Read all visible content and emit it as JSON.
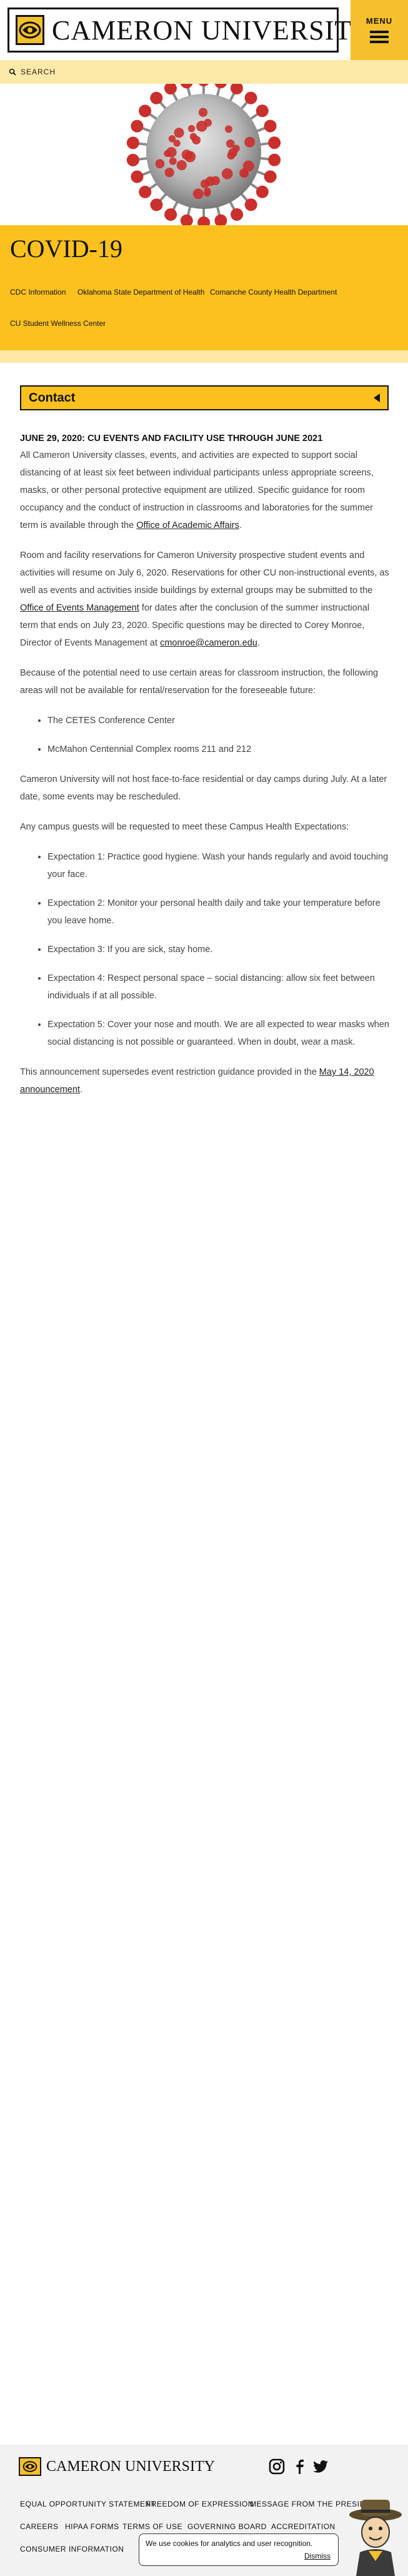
{
  "header": {
    "logo_text": "CAMERON UNIVERSITY",
    "menu_label": "MENU"
  },
  "search": {
    "label": "SEARCH"
  },
  "hero": {
    "title": "COVID-19"
  },
  "band_links": [
    {
      "label": "CDC Information"
    },
    {
      "label": "Oklahoma State Department of Health"
    },
    {
      "label": "Comanche County Health Department"
    },
    {
      "label": "CU Student Wellness Center"
    }
  ],
  "contact": {
    "label": "Contact"
  },
  "article": {
    "heading": "JUNE 29, 2020: CU EVENTS AND FACILITY USE THROUGH JUNE 2021",
    "p1": "All Cameron University classes, events, and activities are expected to support social distancing of at least six feet between individual participants unless appropriate screens, masks, or other personal protective equipment are utilized. Specific guidance for room occupancy and the conduct of instruction in classrooms and laboratories for the summer term is available through the ",
    "p1_link": "Office of Academic Affairs",
    "p1_end": ".",
    "p2": "Room and facility reservations for Cameron University prospective student events and activities will resume on July 6, 2020. Reservations for other CU non-instructional events, as well as events and activities inside buildings by external groups may be submitted to the ",
    "p2_link": "Office of Events Management",
    "p2_mid": " for dates after the conclusion of the summer instructional term that ends on July 23, 2020. Specific questions may be directed to Corey Monroe, Director of Events Management at ",
    "p2_email": "cmonroe@cameron.edu",
    "p2_end": ".",
    "p3": "Because of the potential need to use certain areas for classroom instruction, the following areas will not be available for rental/reservation for the foreseeable future:",
    "areas": [
      "The CETES Conference Center",
      "McMahon Centennial Complex rooms 211 and 212"
    ],
    "p4": "Cameron University will not host face-to-face residential or day camps during July. At a later date, some events may be rescheduled.",
    "p5": "Any campus guests will be requested to meet these Campus Health Expectations:",
    "expectations": [
      "Expectation 1: Practice good hygiene. Wash your hands regularly and avoid touching your face.",
      "Expectation 2: Monitor your personal health daily and take your temperature before you leave home.",
      "Expectation 3: If you are sick, stay home.",
      "Expectation 4: Respect personal space – social distancing: allow six feet between individuals if at all possible.",
      "Expectation 5: Cover your nose and mouth. We are all expected to wear masks when social distancing is not possible or guaranteed. When in doubt, wear a mask."
    ],
    "p6": "This announcement supersedes event restriction guidance provided in the ",
    "p6_link": "May 14, 2020 announcement",
    "p6_end": "."
  },
  "footer": {
    "logo_text": "CAMERON UNIVERSITY",
    "links": [
      "EQUAL OPPORTUNITY STATEMENT",
      "FREEDOM OF EXPRESSION",
      "MESSAGE FROM THE PRESIDENT",
      "CAREERS",
      "HIPAA FORMS",
      "TERMS OF USE",
      "GOVERNING BOARD",
      "ACCREDITATION",
      "CONSUMER INFORMATION"
    ],
    "social": [
      "instagram-icon",
      "facebook-icon",
      "twitter-icon"
    ]
  },
  "cookie": {
    "text": "We use cookies for analytics and user recognition.",
    "dismiss": "Dismiss"
  },
  "colors": {
    "brand_yellow": "#fcc11e",
    "light_yellow": "#fde9a8",
    "virus_red": "#c9302c"
  }
}
